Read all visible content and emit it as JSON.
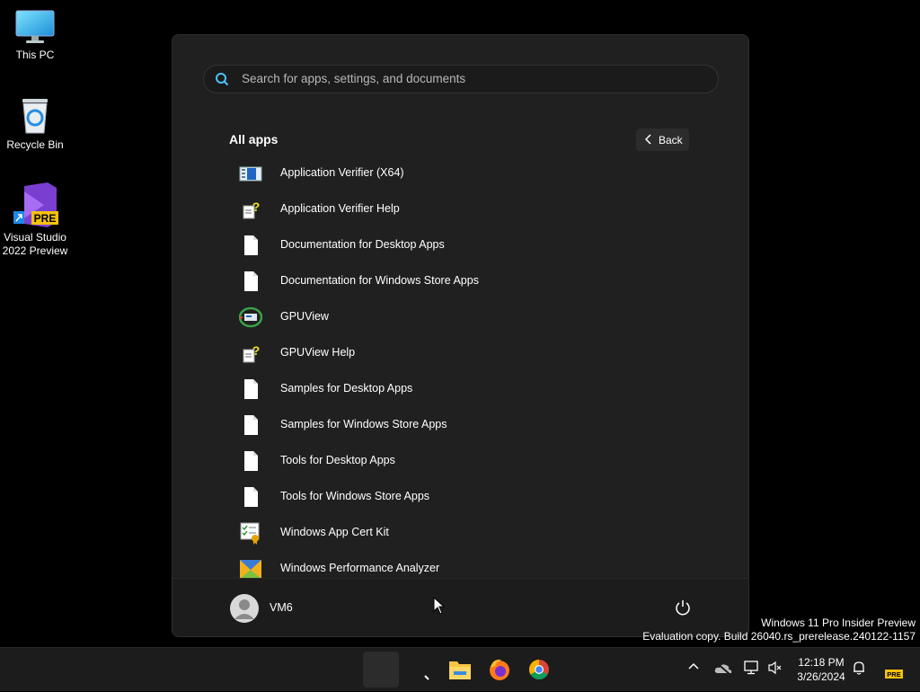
{
  "desktop": {
    "icons": [
      {
        "label": "This PC"
      },
      {
        "label": "Recycle Bin"
      },
      {
        "label_line1": "Visual Studio",
        "label_line2": "2022 Preview",
        "badge": "PRE"
      }
    ]
  },
  "start_menu": {
    "search": {
      "placeholder": "Search for apps, settings, and documents"
    },
    "section_title": "All apps",
    "back_label": "Back",
    "apps": [
      {
        "name": "Application Verifier (X64)",
        "icon": "app-verifier-icon"
      },
      {
        "name": "Application Verifier Help",
        "icon": "help-file-icon"
      },
      {
        "name": "Documentation for Desktop Apps",
        "icon": "document-icon"
      },
      {
        "name": "Documentation for Windows Store Apps",
        "icon": "document-icon"
      },
      {
        "name": "GPUView",
        "icon": "gpuview-icon"
      },
      {
        "name": "GPUView Help",
        "icon": "help-file-icon"
      },
      {
        "name": "Samples for Desktop Apps",
        "icon": "document-icon"
      },
      {
        "name": "Samples for Windows Store Apps",
        "icon": "document-icon"
      },
      {
        "name": "Tools for Desktop Apps",
        "icon": "document-icon"
      },
      {
        "name": "Tools for Windows Store Apps",
        "icon": "document-icon"
      },
      {
        "name": "Windows App Cert Kit",
        "icon": "cert-kit-icon"
      },
      {
        "name": "Windows Performance Analyzer",
        "icon": "performance-analyzer-icon"
      }
    ],
    "user": {
      "name": "VM6"
    }
  },
  "watermark": {
    "line1": "Windows 11 Pro Insider Preview",
    "line2": "Evaluation copy. Build 26040.rs_prerelease.240122-1157"
  },
  "taskbar": {
    "apps": [
      "start-icon",
      "search-icon",
      "file-explorer-icon",
      "firefox-icon",
      "chrome-icon"
    ],
    "clock": {
      "time": "12:18 PM",
      "date": "3/26/2024"
    },
    "tray_badge": "PRE"
  },
  "colors": {
    "accent_blue": "#1a73e8",
    "menu_bg": "#202020",
    "taskbar_bg": "#1c1c1c"
  }
}
